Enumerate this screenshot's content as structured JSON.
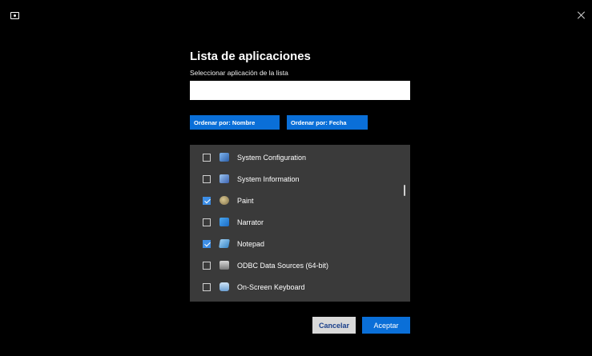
{
  "dialog": {
    "title": "Lista de aplicaciones",
    "subtitle": "Seleccionar aplicación de la lista",
    "search": {
      "value": "",
      "placeholder": ""
    },
    "sort_buttons": {
      "by_name": "Ordenar por: Nombre",
      "by_date": "Ordenar por: Fecha"
    },
    "apps": [
      {
        "label": "System Configuration",
        "checked": false,
        "icon": "system-configuration-icon"
      },
      {
        "label": "System Information",
        "checked": false,
        "icon": "system-information-icon"
      },
      {
        "label": "Paint",
        "checked": true,
        "icon": "paint-icon"
      },
      {
        "label": "Narrator",
        "checked": false,
        "icon": "narrator-icon"
      },
      {
        "label": "Notepad",
        "checked": true,
        "icon": "notepad-icon"
      },
      {
        "label": "ODBC Data Sources (64-bit)",
        "checked": false,
        "icon": "odbc-icon"
      },
      {
        "label": "On-Screen Keyboard",
        "checked": false,
        "icon": "on-screen-keyboard-icon"
      }
    ],
    "actions": {
      "cancel": "Cancelar",
      "accept": "Aceptar"
    }
  },
  "colors": {
    "background": "#000000",
    "accent": "#0a6fd8",
    "list_background": "#3a3a3a",
    "checkbox_checked": "#3d8ee6"
  }
}
